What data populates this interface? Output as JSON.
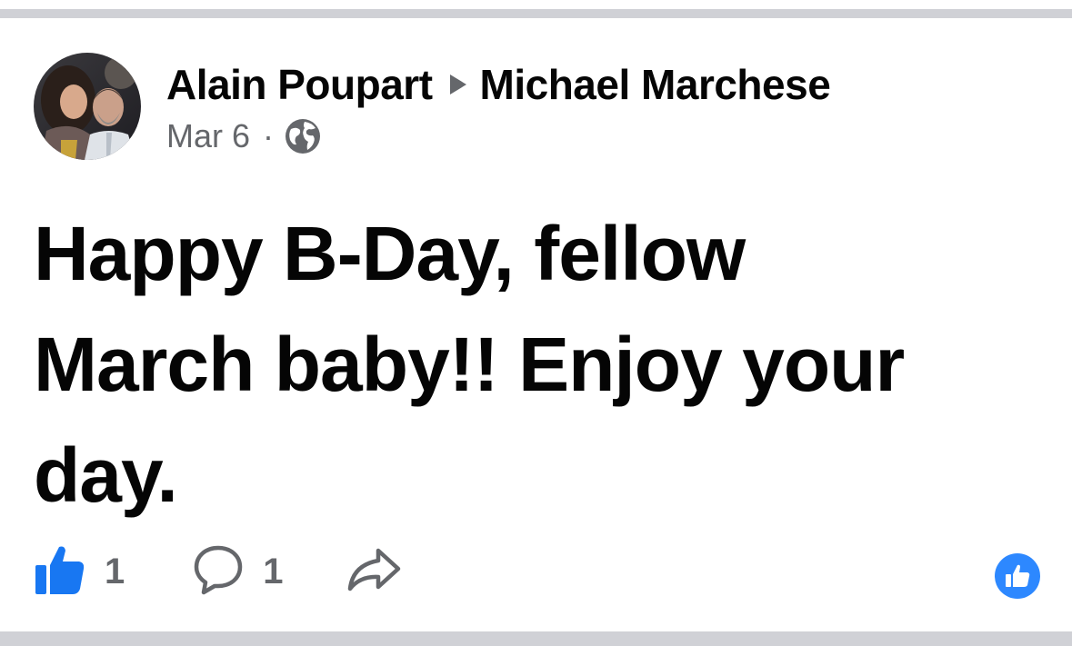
{
  "post": {
    "author": "Alain Poupart",
    "recipient": "Michael Marchese",
    "date": "Mar 6",
    "separator": "·",
    "privacy_icon": "globe-icon",
    "text": "Happy B-Day, fellow March baby!! Enjoy your day."
  },
  "actions": {
    "like_icon": "thumbs-up-icon",
    "like_count": "1",
    "comment_icon": "comment-bubble-icon",
    "comment_count": "1",
    "share_icon": "share-arrow-icon"
  },
  "reactions": {
    "icon": "like-reaction-icon",
    "color": "#2d88ff"
  },
  "colors": {
    "like_blue": "#1877f2",
    "text_primary": "#050505",
    "text_secondary": "#65676b",
    "divider": "#d0d1d6"
  }
}
